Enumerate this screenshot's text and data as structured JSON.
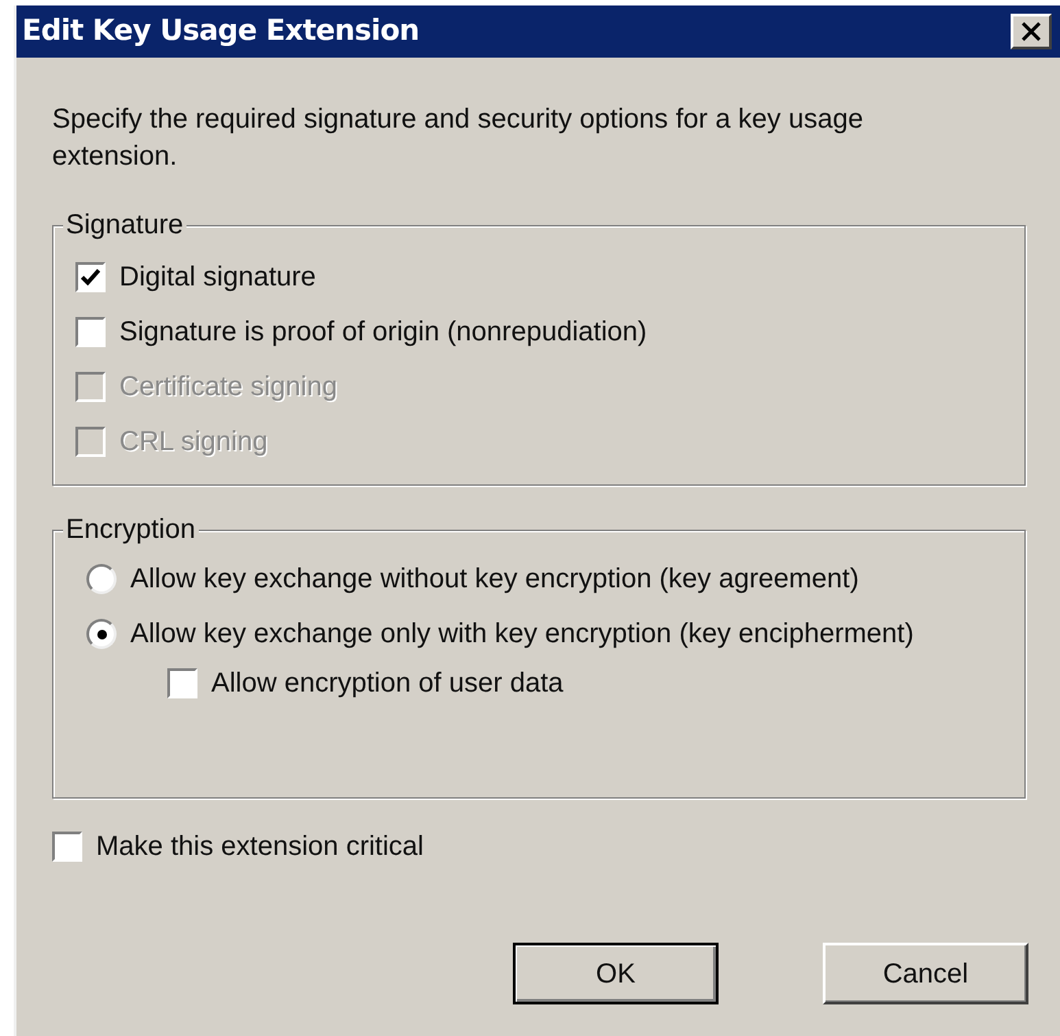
{
  "window": {
    "title": "Edit Key Usage Extension"
  },
  "description": "Specify the required signature and security options for a key usage extension.",
  "signature": {
    "label": "Signature",
    "options": [
      {
        "label": "Digital signature",
        "checked": true,
        "disabled": false
      },
      {
        "label": "Signature is proof of origin (nonrepudiation)",
        "checked": false,
        "disabled": false
      },
      {
        "label": "Certificate signing",
        "checked": false,
        "disabled": true
      },
      {
        "label": "CRL signing",
        "checked": false,
        "disabled": true
      }
    ]
  },
  "encryption": {
    "label": "Encryption",
    "options": [
      {
        "label": "Allow key exchange without key encryption (key agreement)",
        "selected": false
      },
      {
        "label": "Allow key exchange only with key encryption (key encipherment)",
        "selected": true
      }
    ],
    "sub_option": {
      "label": "Allow encryption of user data",
      "checked": false
    }
  },
  "critical": {
    "label": "Make this extension critical",
    "checked": false
  },
  "buttons": [
    {
      "label": "OK",
      "default": true
    },
    {
      "label": "Cancel",
      "default": false
    }
  ]
}
